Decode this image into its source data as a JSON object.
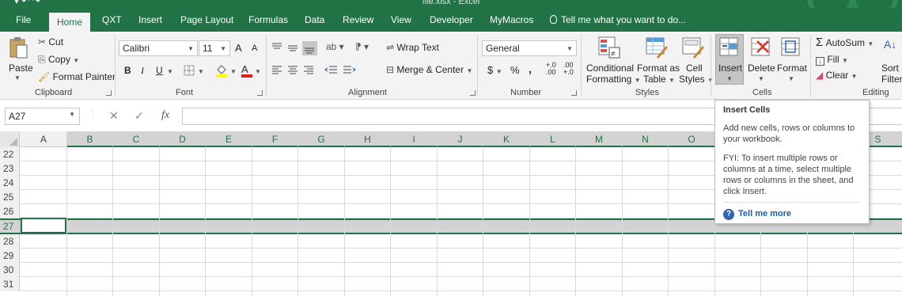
{
  "window": {
    "title": "file.xlsx - Excel"
  },
  "tabs": [
    "File",
    "Home",
    "QXT",
    "Insert",
    "Page Layout",
    "Formulas",
    "Data",
    "Review",
    "View",
    "Developer",
    "MyMacros"
  ],
  "active_tab": "Home",
  "tell_me": "Tell me what you want to do...",
  "clipboard": {
    "paste": "Paste",
    "cut": "Cut",
    "copy": "Copy",
    "format_painter": "Format Painter",
    "label": "Clipboard"
  },
  "font": {
    "name": "Calibri",
    "size": "11",
    "bold": "B",
    "italic": "I",
    "underline": "U",
    "grow": "A",
    "shrink": "A",
    "label": "Font"
  },
  "alignment": {
    "wrap_text": "Wrap Text",
    "merge_center": "Merge & Center",
    "label": "Alignment"
  },
  "number": {
    "format": "General",
    "currency": "$",
    "percent": "%",
    "comma": ",",
    "inc_decimal": "+.0 .00",
    "dec_decimal": ".00 +.0",
    "label": "Number"
  },
  "styles": {
    "conditional_1": "Conditional",
    "conditional_2": "Formatting",
    "format_table_1": "Format as",
    "format_table_2": "Table",
    "cell_styles_1": "Cell",
    "cell_styles_2": "Styles",
    "label": "Styles"
  },
  "cells": {
    "insert": "Insert",
    "delete": "Delete",
    "format": "Format",
    "label": "Cells"
  },
  "editing": {
    "autosum": "AutoSum",
    "fill": "Fill",
    "clear": "Clear",
    "sort_1": "Sort &",
    "sort_2": "Filter",
    "label": "Editing"
  },
  "formula_bar": {
    "name_box": "A27",
    "fx": "fx",
    "formula": ""
  },
  "columns": [
    "A",
    "B",
    "C",
    "D",
    "E",
    "F",
    "G",
    "H",
    "I",
    "J",
    "K",
    "L",
    "M",
    "N",
    "O",
    "S"
  ],
  "rows": [
    "22",
    "23",
    "24",
    "25",
    "26",
    "27",
    "28",
    "29",
    "30",
    "31"
  ],
  "selected_row": "27",
  "tooltip": {
    "title": "Insert Cells",
    "body1": "Add new cells, rows or columns to your workbook.",
    "body2": "FYI: To insert multiple rows or columns at a time, select multiple rows or columns in the sheet, and click Insert.",
    "link": "Tell me more"
  },
  "colors": {
    "accent": "#217346",
    "selection": "#d3d3d3",
    "link": "#1e5fa6"
  }
}
